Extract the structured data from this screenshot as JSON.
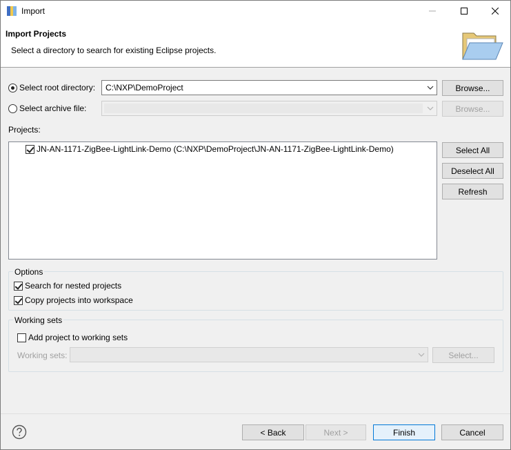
{
  "window": {
    "title": "Import"
  },
  "banner": {
    "title": "Import Projects",
    "description": "Select a directory to search for existing Eclipse projects."
  },
  "source": {
    "root_label": "Select root directory:",
    "root_value": "C:\\NXP\\DemoProject",
    "archive_label": "Select archive file:",
    "archive_value": "",
    "browse_label": "Browse...",
    "browse_disabled_label": "Browse..."
  },
  "projects": {
    "label": "Projects:",
    "items": [
      {
        "label": "JN-AN-1171-ZigBee-LightLink-Demo (C:\\NXP\\DemoProject\\JN-AN-1171-ZigBee-LightLink-Demo)",
        "checked": true
      }
    ],
    "select_all": "Select All",
    "deselect_all": "Deselect All",
    "refresh": "Refresh"
  },
  "options": {
    "title": "Options",
    "nested": "Search for nested projects",
    "copy": "Copy projects into workspace"
  },
  "working_sets": {
    "title": "Working sets",
    "add": "Add project to working sets",
    "field_label": "Working sets:",
    "select_button": "Select..."
  },
  "footer": {
    "back": "< Back",
    "next": "Next >",
    "finish": "Finish",
    "cancel": "Cancel"
  },
  "colors": {
    "accent": "#0078d7",
    "background": "#f0f0f0"
  }
}
